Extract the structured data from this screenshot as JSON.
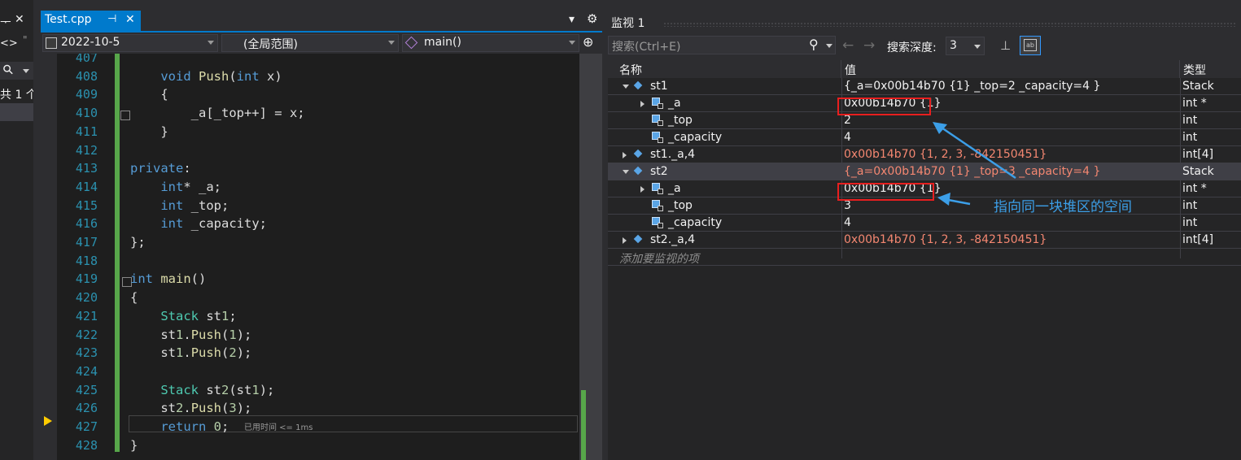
{
  "left_panel": {
    "pin_glyph": "ᅮ",
    "close_glyph": "✕",
    "code_glyph": "<>",
    "quote_glyph": "\"",
    "search_glyph": "⚲",
    "caption": "共 1 个"
  },
  "editor_tab": {
    "title": "Test.cpp",
    "pin": "⊣",
    "close": "✕"
  },
  "tab_menu": {
    "dropdown": "▾",
    "gear": "⚙"
  },
  "nav": {
    "project": "2022-10-5",
    "scope": "(全局范围)",
    "member": "main()",
    "split": "⊕"
  },
  "code": {
    "lines": [
      {
        "n": "407",
        "t": ""
      },
      {
        "n": "408",
        "t": "    void Push(int x)"
      },
      {
        "n": "409",
        "t": "    {"
      },
      {
        "n": "410",
        "t": "        _a[_top++] = x;"
      },
      {
        "n": "411",
        "t": "    }"
      },
      {
        "n": "412",
        "t": ""
      },
      {
        "n": "413",
        "t": "private:"
      },
      {
        "n": "414",
        "t": "    int* _a;"
      },
      {
        "n": "415",
        "t": "    int _top;"
      },
      {
        "n": "416",
        "t": "    int _capacity;"
      },
      {
        "n": "417",
        "t": "};"
      },
      {
        "n": "418",
        "t": ""
      },
      {
        "n": "419",
        "t": "int main()"
      },
      {
        "n": "420",
        "t": "{"
      },
      {
        "n": "421",
        "t": "    Stack st1;"
      },
      {
        "n": "422",
        "t": "    st1.Push(1);"
      },
      {
        "n": "423",
        "t": "    st1.Push(2);"
      },
      {
        "n": "424",
        "t": ""
      },
      {
        "n": "425",
        "t": "    Stack st2(st1);"
      },
      {
        "n": "426",
        "t": "    st2.Push(3);"
      },
      {
        "n": "427",
        "t": "    return 0;"
      },
      {
        "n": "428",
        "t": "}"
      }
    ],
    "perf_tip": "已用时间 <= 1ms"
  },
  "watch": {
    "title": "监视 1",
    "search_placeholder": "搜索(Ctrl+E)",
    "search_depth_label": "搜索深度:",
    "search_depth_value": "3",
    "columns": {
      "name": "名称",
      "value": "值",
      "type": "类型"
    },
    "rows": [
      {
        "name": "st1",
        "value": "{_a=0x00b14b70 {1} _top=2 _capacity=4 }",
        "type": "Stack"
      },
      {
        "name": "_a",
        "value": "0x00b14b70 {1}",
        "type": "int *"
      },
      {
        "name": "_top",
        "value": "2",
        "type": "int"
      },
      {
        "name": "_capacity",
        "value": "4",
        "type": "int"
      },
      {
        "name": "st1._a,4",
        "value": "0x00b14b70 {1, 2, 3, -842150451}",
        "type": "int[4]"
      },
      {
        "name": "st2",
        "value": "{_a=0x00b14b70 {1} _top=3 _capacity=4 }",
        "type": "Stack"
      },
      {
        "name": "_a",
        "value": "0x00b14b70 {1}",
        "type": "int *"
      },
      {
        "name": "_top",
        "value": "3",
        "type": "int"
      },
      {
        "name": "_capacity",
        "value": "4",
        "type": "int"
      },
      {
        "name": "st2._a,4",
        "value": "0x00b14b70 {1, 2, 3, -842150451}",
        "type": "int[4]"
      }
    ],
    "add_item_placeholder": "添加要监视的项"
  },
  "annotation": "指向同一块堆区的空间",
  "colors": {
    "accent": "#007acc",
    "changed_value": "#f48771",
    "highlight_box": "#e81f1f",
    "annotation": "#3c9fe8"
  }
}
